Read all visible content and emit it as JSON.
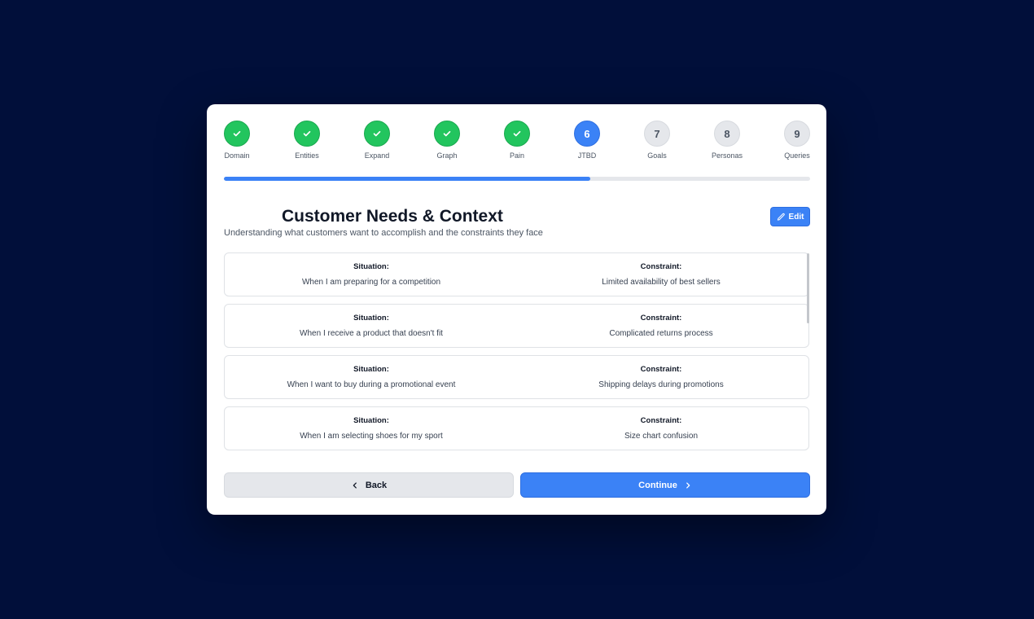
{
  "stepper": {
    "steps": [
      {
        "label": "Domain",
        "number": "1",
        "state": "done"
      },
      {
        "label": "Entities",
        "number": "2",
        "state": "done"
      },
      {
        "label": "Expand",
        "number": "3",
        "state": "done"
      },
      {
        "label": "Graph",
        "number": "4",
        "state": "done"
      },
      {
        "label": "Pain",
        "number": "5",
        "state": "done"
      },
      {
        "label": "JTBD",
        "number": "6",
        "state": "current"
      },
      {
        "label": "Goals",
        "number": "7",
        "state": "todo"
      },
      {
        "label": "Personas",
        "number": "8",
        "state": "todo"
      },
      {
        "label": "Queries",
        "number": "9",
        "state": "todo"
      }
    ],
    "progress_fraction": 0.625
  },
  "header": {
    "title": "Customer Needs & Context",
    "subtitle": "Understanding what customers want to accomplish and the constraints they face",
    "edit_label": "Edit"
  },
  "cards": [
    {
      "situation_label": "Situation:",
      "situation": "When I am preparing for a competition",
      "constraint_label": "Constraint:",
      "constraint": "Limited availability of best sellers"
    },
    {
      "situation_label": "Situation:",
      "situation": "When I receive a product that doesn't fit",
      "constraint_label": "Constraint:",
      "constraint": "Complicated returns process"
    },
    {
      "situation_label": "Situation:",
      "situation": "When I want to buy during a promotional event",
      "constraint_label": "Constraint:",
      "constraint": "Shipping delays during promotions"
    },
    {
      "situation_label": "Situation:",
      "situation": "When I am selecting shoes for my sport",
      "constraint_label": "Constraint:",
      "constraint": "Size chart confusion"
    },
    {
      "situation_label": "",
      "situation": "",
      "constraint_label": "",
      "constraint": ""
    }
  ],
  "footer": {
    "back_label": "Back",
    "continue_label": "Continue"
  },
  "colors": {
    "background": "#010f3a",
    "done": "#22c55e",
    "accent": "#3b82f6",
    "todo": "#e5e7eb"
  },
  "icons": {
    "done_step": "check-icon",
    "edit": "pencil-icon",
    "back": "chevron-left-icon",
    "continue": "chevron-right-icon"
  }
}
